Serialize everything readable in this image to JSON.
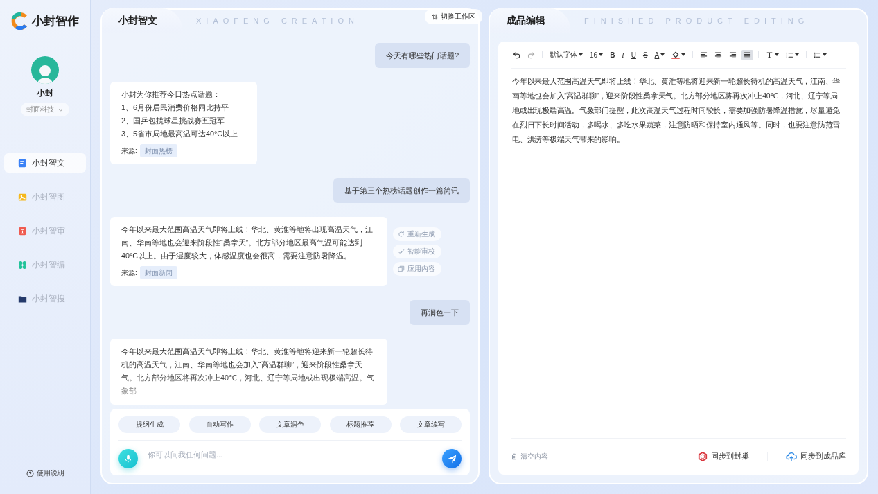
{
  "app": {
    "logo_text": "小封智作"
  },
  "profile": {
    "name": "小封",
    "org": "封面科技"
  },
  "nav": [
    {
      "label": "小封智文",
      "kind": "doc",
      "color": "#3b82f6",
      "selected": true
    },
    {
      "label": "小封智图",
      "kind": "image",
      "color": "#f5b81c",
      "selected": false
    },
    {
      "label": "小封智审",
      "kind": "review",
      "color": "#ef5b50",
      "selected": false
    },
    {
      "label": "小封智编",
      "kind": "grid",
      "color": "#22c39a",
      "selected": false
    },
    {
      "label": "小封智搜",
      "kind": "folder",
      "color": "#253a6b",
      "selected": false
    }
  ],
  "help": "使用说明",
  "chat_panel": {
    "tab": "小封智文",
    "watermark": "XIAOFENG CREATION",
    "switch_button": "切换工作区",
    "messages": [
      {
        "kind": "user",
        "text": "今天有哪些热门话题?"
      },
      {
        "kind": "bot",
        "lines": [
          "小封为你推荐今日热点话题：",
          "1、6月份居民消费价格同比持平",
          "2、国乒包揽球星挑战赛五冠军",
          "3、5省市局地最高温可达40°C以上"
        ],
        "source_label": "来源:",
        "source": "封面热榜",
        "faded": false
      },
      {
        "kind": "user",
        "text": "基于第三个热榜话题创作一篇简讯"
      },
      {
        "kind": "bot",
        "lines": [
          "今年以来最大范围高温天气即将上线！华北、黄淮等地将出现高温天气，江南、华南等地也会迎来阶段性“桑拿天”。北方部分地区最高气温可能达到40°C以上。由于湿度较大，体感温度也会很高，需要注意防暑降温。"
        ],
        "source_label": "来源:",
        "source": "封面新闻",
        "faded": false,
        "actions": [
          {
            "kind": "refresh",
            "label": "重新生成"
          },
          {
            "kind": "check",
            "label": "智能审校"
          },
          {
            "kind": "copy",
            "label": "应用内容"
          }
        ]
      },
      {
        "kind": "user",
        "text": "再润色一下"
      },
      {
        "kind": "bot",
        "lines": [
          "今年以来最大范围高温天气即将上线！华北、黄淮等地将迎来新一轮超长待机的高温天气，江南、华南等地也会加入“高温群聊”，迎来阶段性桑拿天气。北方部分地区将再次冲上40℃，河北、辽宁等局地或出现极端高温。气象部"
        ],
        "faded": true
      }
    ],
    "quick_actions": [
      "提纲生成",
      "自动写作",
      "文章润色",
      "标题推荐",
      "文章续写"
    ],
    "input": {
      "placeholder": "你可以问我任何问题..."
    }
  },
  "editor_panel": {
    "tab": "成品编辑",
    "watermark": "FINISHED PRODUCT EDITING",
    "toolbar": [
      [
        {
          "kind": "undo",
          "selected": false
        },
        {
          "kind": "redo",
          "selected": false
        }
      ],
      [
        {
          "kind": "font",
          "label": "默认字体",
          "selected": false
        },
        {
          "kind": "size",
          "label": "16",
          "selected": false
        },
        {
          "kind": "bold",
          "label": "B",
          "selected": false
        },
        {
          "kind": "italic",
          "label": "I",
          "selected": false
        },
        {
          "kind": "underline",
          "label": "U",
          "selected": false
        },
        {
          "kind": "strike",
          "label": "S",
          "selected": false
        },
        {
          "kind": "color",
          "label": "A",
          "selected": false
        },
        {
          "kind": "fill",
          "selected": false
        }
      ],
      [
        {
          "kind": "align-left",
          "selected": false
        },
        {
          "kind": "align-center",
          "selected": false
        },
        {
          "kind": "align-right",
          "selected": false
        },
        {
          "kind": "justify",
          "selected": true
        }
      ],
      [
        {
          "kind": "line-height",
          "selected": false
        },
        {
          "kind": "indent",
          "selected": false
        }
      ],
      [
        {
          "kind": "list",
          "selected": false
        }
      ]
    ],
    "content": "今年以来最大范围高温天气即将上线！华北、黄淮等地将迎来新一轮超长待机的高温天气，江南、华南等地也会加入“高温群聊”，迎来阶段性桑拿天气。北方部分地区将再次冲上40℃，河北、辽宁等局地或出现极端高温。气象部门提醒，此次高温天气过程时间较长，需要加强防暑降温措施，尽量避免在烈日下长时间活动，多喝水、多吃水果蔬菜，注意防晒和保持室内通风等。同时，也要注意防范雷电、洪涝等极端天气带来的影响。",
    "clear_button": "清空内容",
    "sync_buttons": [
      {
        "kind": "nest",
        "label": "同步到封巢"
      },
      {
        "kind": "library",
        "label": "同步到成品库"
      }
    ]
  }
}
